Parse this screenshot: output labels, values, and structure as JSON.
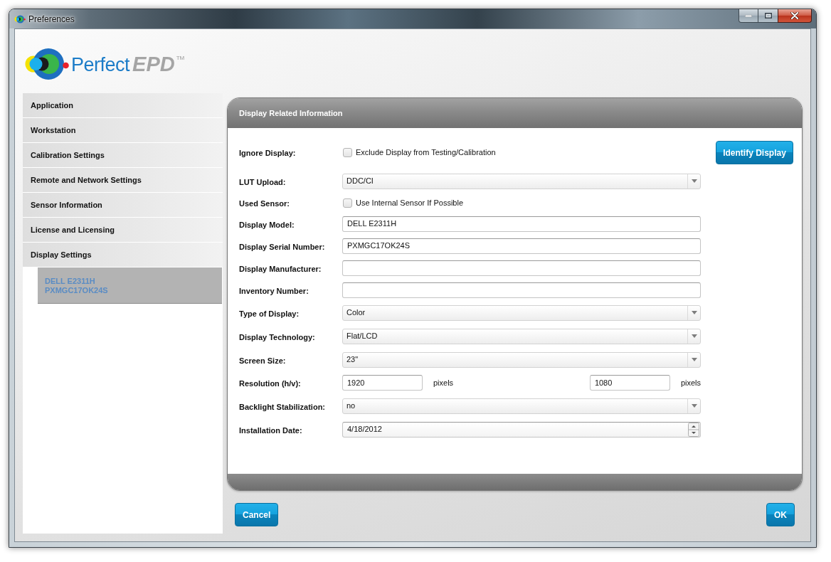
{
  "window": {
    "title": "Preferences"
  },
  "logo": {
    "wordmark": [
      "Perfect",
      "EPD"
    ],
    "mark": "TM"
  },
  "sidebar": {
    "items": [
      {
        "label": "Application",
        "selected": false
      },
      {
        "label": "Workstation",
        "selected": false
      },
      {
        "label": "Calibration Settings",
        "selected": false
      },
      {
        "label": "Remote and Network Settings",
        "selected": false
      },
      {
        "label": "Sensor Information",
        "selected": false
      },
      {
        "label": "License and Licensing",
        "selected": false
      },
      {
        "label": "Display Settings",
        "selected": false,
        "children": [
          {
            "lines": [
              "DELL E2311H",
              "PXMGC17OK24S"
            ],
            "selected": true
          }
        ]
      }
    ]
  },
  "panel": {
    "title": "Display Related Information",
    "action": "Identify Display",
    "rows": [
      {
        "kind": "checkbox",
        "label": "Ignore Display:",
        "text": "Exclude Display from Testing/Calibration",
        "checked": false
      },
      {
        "kind": "select",
        "label": "LUT Upload:",
        "value": "DDC/CI"
      },
      {
        "kind": "checkbox",
        "label": "Used Sensor:",
        "text": "Use Internal Sensor If Possible",
        "checked": false
      },
      {
        "kind": "text",
        "label": "Display Model:",
        "value": "DELL E2311H"
      },
      {
        "kind": "text",
        "label": "Display Serial Number:",
        "value": "PXMGC17OK24S"
      },
      {
        "kind": "text",
        "label": "Display Manufacturer:"
      },
      {
        "kind": "text",
        "label": "Inventory Number:"
      },
      {
        "kind": "select",
        "label": "Type of Display:",
        "value": "Color"
      },
      {
        "kind": "select",
        "label": "Display Technology:",
        "value": "Flat/LCD"
      },
      {
        "kind": "select",
        "label": "Screen Size:",
        "value": "23\""
      },
      {
        "kind": "pair",
        "label": "Resolution (h/v):",
        "fields": [
          {
            "value": "1920",
            "unit": "pixels"
          },
          {
            "value": "1080",
            "unit": "pixels"
          }
        ]
      },
      {
        "kind": "select",
        "label": "Backlight Stabilization:",
        "value": "no"
      },
      {
        "kind": "date",
        "label": "Installation Date:",
        "value": "4/18/2012"
      }
    ]
  },
  "footer_buttons": [
    "Cancel",
    "OK"
  ]
}
